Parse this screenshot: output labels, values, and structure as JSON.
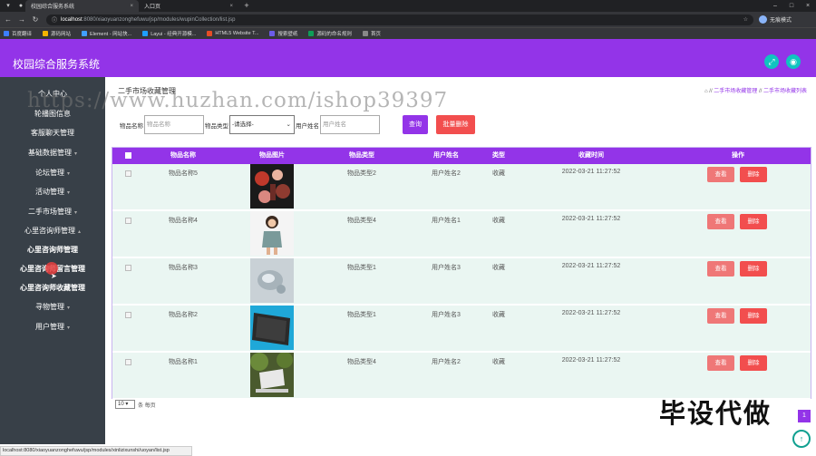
{
  "browser": {
    "tabs": [
      {
        "label": "校园综合服务系统",
        "active": true
      },
      {
        "label": "入口页",
        "active": false
      }
    ],
    "url_host": "localhost",
    "url_path": ":8080/xiaoyuanzonghefuwu/jsp/modules/wupinCollection/list.jsp",
    "profile": "无痕模式",
    "bookmarks": [
      {
        "label": "百度翻译",
        "color": "#3d7eff"
      },
      {
        "label": "源码网站",
        "color": "#f4b400"
      },
      {
        "label": "Element - 网站快...",
        "color": "#409eff"
      },
      {
        "label": "Layui - 经典开源模...",
        "color": "#1e9fff"
      },
      {
        "label": "HTML5 Website T...",
        "color": "#e44d26"
      },
      {
        "label": "搜索壁纸",
        "color": "#6c5ce7"
      },
      {
        "label": "源码的命名规则",
        "color": "#0f9d58"
      },
      {
        "label": "首页",
        "color": "#888888"
      }
    ],
    "status_url": "localhost:8080/xiaoyuanzonghefuwu/jsp/modules/xinlizixunshi/uoyan/list.jsp"
  },
  "app": {
    "title": "校园综合服务系统"
  },
  "sidebar": {
    "items": [
      {
        "label": "个人中心",
        "bold": false,
        "arrow": false
      },
      {
        "label": "轮播图信息",
        "bold": false,
        "arrow": false
      },
      {
        "label": "客服聊天管理",
        "bold": false,
        "arrow": false
      },
      {
        "label": "基础数据管理",
        "bold": false,
        "arrow": true
      },
      {
        "label": "论坛管理",
        "bold": false,
        "arrow": true
      },
      {
        "label": "活动管理",
        "bold": false,
        "arrow": true
      },
      {
        "label": "二手市场管理",
        "bold": false,
        "arrow": true
      },
      {
        "label": "心里咨询师管理",
        "bold": false,
        "arrow": true
      },
      {
        "label": "心里咨询师管理",
        "bold": true,
        "arrow": false
      },
      {
        "label": "心里咨询师留言管理",
        "bold": true,
        "arrow": false
      },
      {
        "label": "心里咨询师收藏管理",
        "bold": true,
        "arrow": false
      },
      {
        "label": "寻物管理",
        "bold": false,
        "arrow": true
      },
      {
        "label": "用户管理",
        "bold": false,
        "arrow": true
      }
    ]
  },
  "page": {
    "title": "二手市场收藏管理",
    "breadcrumb": [
      "二手市场收藏管理",
      "二手市场收藏列表"
    ]
  },
  "search": {
    "name_label": "物品名称",
    "name_placeholder": "物品名称",
    "type_label": "物品类型",
    "type_selected": "-请选择-",
    "user_label": "用户姓名",
    "user_placeholder": "用户姓名",
    "search_button": "查询",
    "batch_delete_button": "批量删除"
  },
  "table": {
    "headers": [
      "物品名称",
      "物品图片",
      "物品类型",
      "用户姓名",
      "类型",
      "收藏时间",
      "操作"
    ],
    "view_label": "查看",
    "delete_label": "删除",
    "rows": [
      {
        "name": "物品名称5",
        "type": "物品类型2",
        "user": "用户姓名2",
        "kind": "收藏",
        "time": "2022-03-21 11:27:52",
        "image": "cosmetics"
      },
      {
        "name": "物品名称4",
        "type": "物品类型4",
        "user": "用户姓名1",
        "kind": "收藏",
        "time": "2022-03-21 11:27:52",
        "image": "doll"
      },
      {
        "name": "物品名称3",
        "type": "物品类型1",
        "user": "用户姓名3",
        "kind": "收藏",
        "time": "2022-03-21 11:27:52",
        "image": "glass"
      },
      {
        "name": "物品名称2",
        "type": "物品类型1",
        "user": "用户姓名3",
        "kind": "收藏",
        "time": "2022-03-21 11:27:52",
        "image": "tablet"
      },
      {
        "name": "物品名称1",
        "type": "物品类型4",
        "user": "用户姓名2",
        "kind": "收藏",
        "time": "2022-03-21 11:27:52",
        "image": "laptop"
      }
    ]
  },
  "pager": {
    "page_size": "10",
    "page_size_suffix": "条 每页",
    "current_page": "1"
  },
  "overlay": {
    "watermark": "https://www.huzhan.com/ishop39397",
    "big_text": "毕设代做"
  },
  "colors": {
    "primary": "#9334e8",
    "danger": "#f24e4e",
    "view": "#ef7777",
    "sidebar": "#384048",
    "teal": "#10c4c0"
  }
}
